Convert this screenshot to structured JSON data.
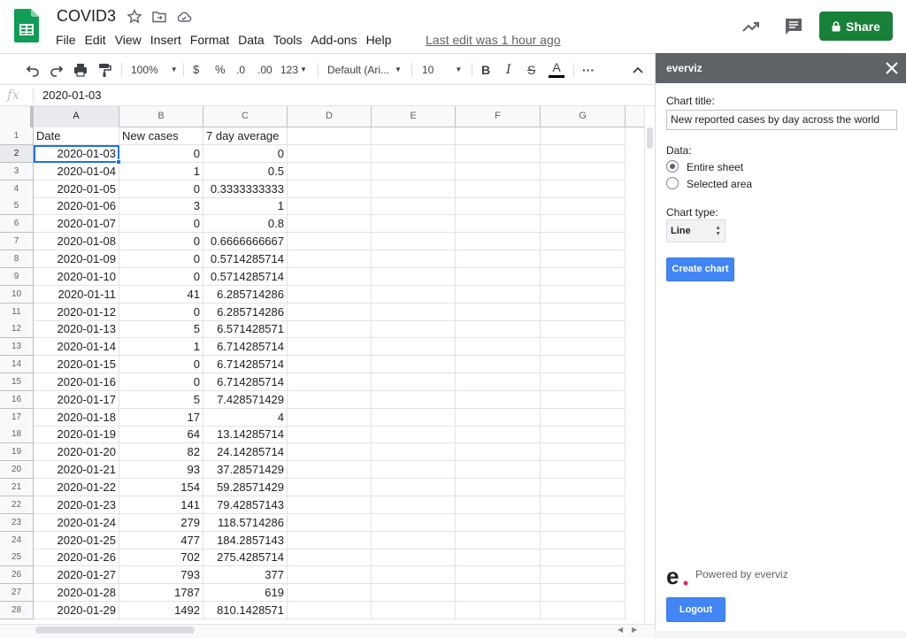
{
  "header": {
    "title": "COVID3",
    "menu": [
      "File",
      "Edit",
      "View",
      "Insert",
      "Format",
      "Data",
      "Tools",
      "Add-ons",
      "Help"
    ],
    "last_edit": "Last edit was 1 hour ago",
    "share_label": "Share"
  },
  "toolbar": {
    "zoom": "100%",
    "currency": "$",
    "percent": "%",
    "decrease_decimal": ".0",
    "increase_decimal": ".00",
    "more_formats": "123",
    "font": "Default (Ari...",
    "font_size": "10",
    "bold": "B",
    "italic": "I",
    "strikethrough": "S",
    "text_color": "A",
    "more": "···"
  },
  "formula_bar": {
    "label": "fx",
    "value": "2020-01-03"
  },
  "grid": {
    "columns": [
      "A",
      "B",
      "C",
      "D",
      "E",
      "F",
      "G"
    ],
    "rows": [
      {
        "n": "1",
        "a": "Date",
        "b": "New cases",
        "c": "7 day average"
      },
      {
        "n": "2",
        "a": "2020-01-03",
        "b": "0",
        "c": "0"
      },
      {
        "n": "3",
        "a": "2020-01-04",
        "b": "1",
        "c": "0.5"
      },
      {
        "n": "4",
        "a": "2020-01-05",
        "b": "0",
        "c": "0.3333333333"
      },
      {
        "n": "5",
        "a": "2020-01-06",
        "b": "3",
        "c": "1"
      },
      {
        "n": "6",
        "a": "2020-01-07",
        "b": "0",
        "c": "0.8"
      },
      {
        "n": "7",
        "a": "2020-01-08",
        "b": "0",
        "c": "0.6666666667"
      },
      {
        "n": "8",
        "a": "2020-01-09",
        "b": "0",
        "c": "0.5714285714"
      },
      {
        "n": "9",
        "a": "2020-01-10",
        "b": "0",
        "c": "0.5714285714"
      },
      {
        "n": "10",
        "a": "2020-01-11",
        "b": "41",
        "c": "6.285714286"
      },
      {
        "n": "11",
        "a": "2020-01-12",
        "b": "0",
        "c": "6.285714286"
      },
      {
        "n": "12",
        "a": "2020-01-13",
        "b": "5",
        "c": "6.571428571"
      },
      {
        "n": "13",
        "a": "2020-01-14",
        "b": "1",
        "c": "6.714285714"
      },
      {
        "n": "14",
        "a": "2020-01-15",
        "b": "0",
        "c": "6.714285714"
      },
      {
        "n": "15",
        "a": "2020-01-16",
        "b": "0",
        "c": "6.714285714"
      },
      {
        "n": "16",
        "a": "2020-01-17",
        "b": "5",
        "c": "7.428571429"
      },
      {
        "n": "17",
        "a": "2020-01-18",
        "b": "17",
        "c": "4"
      },
      {
        "n": "18",
        "a": "2020-01-19",
        "b": "64",
        "c": "13.14285714"
      },
      {
        "n": "19",
        "a": "2020-01-20",
        "b": "82",
        "c": "24.14285714"
      },
      {
        "n": "20",
        "a": "2020-01-21",
        "b": "93",
        "c": "37.28571429"
      },
      {
        "n": "21",
        "a": "2020-01-22",
        "b": "154",
        "c": "59.28571429"
      },
      {
        "n": "22",
        "a": "2020-01-23",
        "b": "141",
        "c": "79.42857143"
      },
      {
        "n": "23",
        "a": "2020-01-24",
        "b": "279",
        "c": "118.5714286"
      },
      {
        "n": "24",
        "a": "2020-01-25",
        "b": "477",
        "c": "184.2857143"
      },
      {
        "n": "25",
        "a": "2020-01-26",
        "b": "702",
        "c": "275.4285714"
      },
      {
        "n": "26",
        "a": "2020-01-27",
        "b": "793",
        "c": "377"
      },
      {
        "n": "27",
        "a": "2020-01-28",
        "b": "1787",
        "c": "619"
      },
      {
        "n": "28",
        "a": "2020-01-29",
        "b": "1492",
        "c": "810.1428571"
      }
    ]
  },
  "panel": {
    "title": "everviz",
    "chart_title_label": "Chart title:",
    "chart_title_value": "New reported cases by day across the world",
    "data_label": "Data:",
    "data_options": [
      "Entire sheet",
      "Selected area"
    ],
    "chart_type_label": "Chart type:",
    "chart_type_value": "Line",
    "create_chart_label": "Create chart",
    "powered_by": "Powered by everviz",
    "logout_label": "Logout"
  },
  "colors": {
    "share_green": "#188038",
    "selection_blue": "#1a73e8",
    "panel_header": "#5f6368",
    "button_blue": "#4285f4"
  }
}
